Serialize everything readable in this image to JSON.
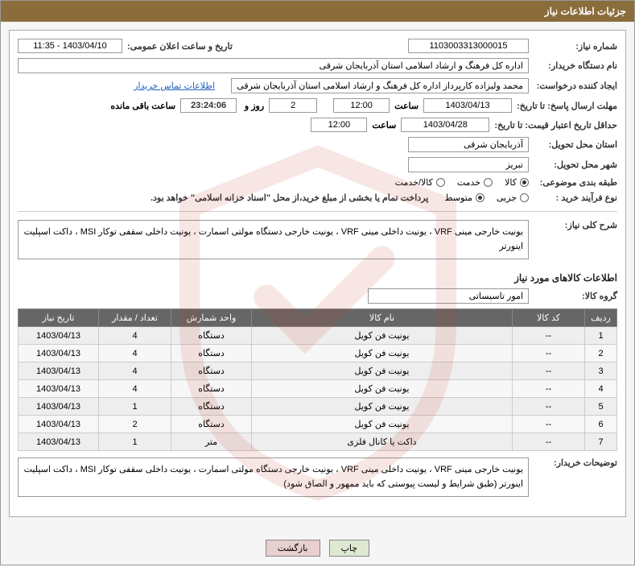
{
  "header": {
    "title": "جزئیات اطلاعات نیاز"
  },
  "fields": {
    "need_number_label": "شماره نیاز:",
    "need_number": "1103003313000015",
    "announce_label": "تاریخ و ساعت اعلان عمومی:",
    "announce_value": "1403/04/10 - 11:35",
    "buyer_org_label": "نام دستگاه خریدار:",
    "buyer_org": "اداره کل فرهنگ و ارشاد اسلامی استان آذربایجان شرقی",
    "requester_label": "ایجاد کننده درخواست:",
    "requester": "محمد ولیزاده کارپرداز اداره کل فرهنگ و ارشاد اسلامی استان آذربایجان شرقی",
    "contact_link": "اطلاعات تماس خریدار",
    "deadline_label": "مهلت ارسال پاسخ: تا تاریخ:",
    "deadline_date": "1403/04/13",
    "time_label": "ساعت",
    "deadline_time": "12:00",
    "days_value": "2",
    "days_label": "روز و",
    "countdown": "23:24:06",
    "remaining_label": "ساعت باقی مانده",
    "validity_label": "حداقل تاریخ اعتبار قیمت: تا تاریخ:",
    "validity_date": "1403/04/28",
    "validity_time": "12:00",
    "province_label": "استان محل تحویل:",
    "province": "آذربایجان شرقی",
    "city_label": "شهر محل تحویل:",
    "city": "تبریز",
    "category_label": "طبقه بندی موضوعی:",
    "radio_goods": "کالا",
    "radio_service": "خدمت",
    "radio_both": "کالا/خدمت",
    "process_label": "نوع فرآیند خرید :",
    "radio_small": "جزیی",
    "radio_medium": "متوسط",
    "payment_note": "پرداخت تمام یا بخشی از مبلغ خرید،از محل \"اسناد خزانه اسلامی\" خواهد بود.",
    "summary_label": "شرح کلی نیاز:",
    "summary_text": "یونیت خارجی مینی VRF ، یونیت داخلی مینی VRF ، یونیت خارجی دستگاه مولتی اسمارت ، یونیت داخلی سقفی توکار MSI ، داکت اسپلیت اینورتر",
    "goods_section": "اطلاعات کالاهای مورد نیاز",
    "group_label": "گروه کالا:",
    "group_value": "امور تاسیساتی",
    "buyer_notes_label": "توضیحات خریدار:",
    "buyer_notes_text": "یونیت خارجی مینی VRF ، یونیت داخلی مینی VRF ، یونیت خارجی دستگاه مولتی اسمارت ، یونیت داخلی سقفی توکار MSI ، داکت اسپلیت اینورتر   (طبق شرایط و لیست پیوستی که باید ممهور و الصاق شود)"
  },
  "table": {
    "headers": {
      "row": "ردیف",
      "code": "کد کالا",
      "name": "نام کالا",
      "unit": "واحد شمارش",
      "qty": "تعداد / مقدار",
      "date": "تاریخ نیاز"
    },
    "rows": [
      {
        "row": "1",
        "code": "--",
        "name": "یونیت فن کویل",
        "unit": "دستگاه",
        "qty": "4",
        "date": "1403/04/13"
      },
      {
        "row": "2",
        "code": "--",
        "name": "یونیت فن کویل",
        "unit": "دستگاه",
        "qty": "4",
        "date": "1403/04/13"
      },
      {
        "row": "3",
        "code": "--",
        "name": "یونیت فن کویل",
        "unit": "دستگاه",
        "qty": "4",
        "date": "1403/04/13"
      },
      {
        "row": "4",
        "code": "--",
        "name": "یونیت فن کویل",
        "unit": "دستگاه",
        "qty": "4",
        "date": "1403/04/13"
      },
      {
        "row": "5",
        "code": "--",
        "name": "یونیت فن کویل",
        "unit": "دستگاه",
        "qty": "1",
        "date": "1403/04/13"
      },
      {
        "row": "6",
        "code": "--",
        "name": "یونیت فن کویل",
        "unit": "دستگاه",
        "qty": "2",
        "date": "1403/04/13"
      },
      {
        "row": "7",
        "code": "--",
        "name": "داکت یا کانال فلزی",
        "unit": "متر",
        "qty": "1",
        "date": "1403/04/13"
      }
    ]
  },
  "buttons": {
    "print": "چاپ",
    "back": "بازگشت"
  }
}
